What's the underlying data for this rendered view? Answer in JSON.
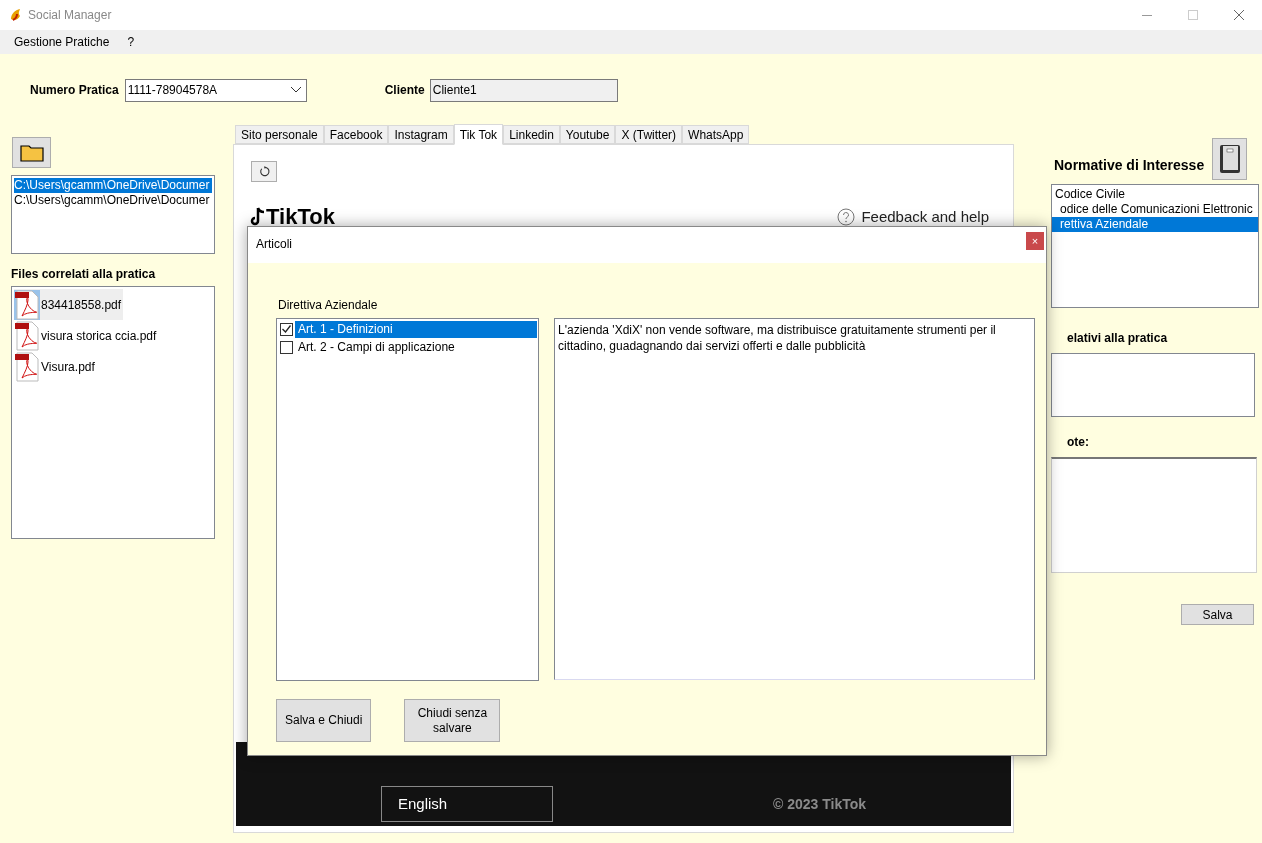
{
  "window": {
    "title": "Social Manager"
  },
  "menu": [
    "Gestione Pratiche",
    "?"
  ],
  "header": {
    "numero_label": "Numero Pratica",
    "numero_value": "1111-78904578A",
    "cliente_label": "Cliente",
    "cliente_value": "Cliente1"
  },
  "folders": [
    {
      "path": "C:\\Users\\gcamm\\OneDrive\\Documer",
      "selected": true
    },
    {
      "path": "C:\\Users\\gcamm\\OneDrive\\Documer",
      "selected": false
    }
  ],
  "files_label": "Files correlati alla pratica",
  "files": [
    {
      "name": "834418558.pdf",
      "selected": true
    },
    {
      "name": "visura storica ccia.pdf",
      "selected": false
    },
    {
      "name": "Visura.pdf",
      "selected": false
    }
  ],
  "tabs": [
    {
      "label": "Sito personale",
      "selected": false
    },
    {
      "label": "Facebook",
      "selected": false
    },
    {
      "label": "Instagram",
      "selected": false
    },
    {
      "label": "Tik Tok",
      "selected": true
    },
    {
      "label": "Linkedin",
      "selected": false
    },
    {
      "label": "Youtube",
      "selected": false
    },
    {
      "label": "X (Twitter)",
      "selected": false
    },
    {
      "label": "WhatsApp",
      "selected": false
    }
  ],
  "webview": {
    "logo": "TikTok",
    "help": "Feedback and help",
    "language": "English",
    "copyright": "© 2023 TikTok"
  },
  "right": {
    "title": "Normative di Interesse",
    "normative": [
      {
        "label": "Codice Civile",
        "selected": false
      },
      {
        "label": "odice delle Comunicazioni Elettronic",
        "selected": false
      },
      {
        "label": "rettiva Aziendale",
        "selected": true
      }
    ],
    "related_label": "elativi alla pratica",
    "notes_label": "ote:",
    "save": "Salva"
  },
  "dialog": {
    "title": "Articoli",
    "close": "×",
    "group_label": "Direttiva Aziendale",
    "articles": [
      {
        "label": "Art. 1 - Definizioni",
        "checked": true,
        "selected": true
      },
      {
        "label": "Art. 2 - Campi di applicazione",
        "checked": false,
        "selected": false
      }
    ],
    "text": "L'azienda 'XdiX' non vende software, ma distribuisce gratuitamente strumenti per il cittadino, guadagnando dai servizi offerti e dalle pubblicità",
    "buttons": [
      "Salva e Chiudi",
      "Chiudi senza salvare"
    ]
  }
}
